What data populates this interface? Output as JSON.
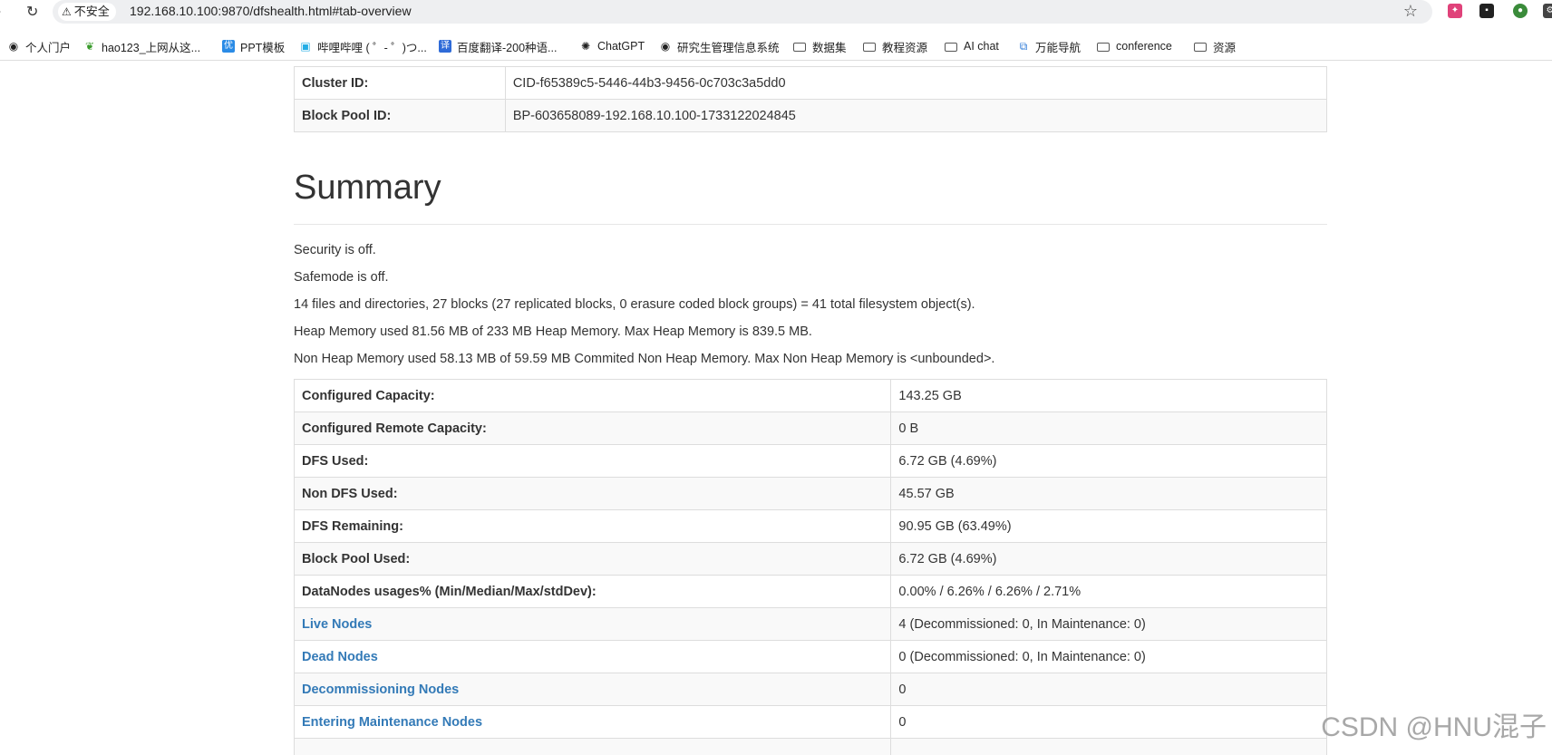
{
  "browser": {
    "security_label": "不安全",
    "url": "192.168.10.100:9870/dfshealth.html#tab-overview"
  },
  "bookmarks": [
    {
      "label": "个人门户",
      "icon": "globe-icon"
    },
    {
      "label": "hao123_上网从这...",
      "icon": "hao123-icon"
    },
    {
      "label": "PPT模板",
      "icon": "ppt-icon"
    },
    {
      "label": "哔哩哔哩 ( ゜- ゜)つ...",
      "icon": "bilibili-icon"
    },
    {
      "label": "百度翻译-200种语...",
      "icon": "translate-icon"
    },
    {
      "label": "ChatGPT",
      "icon": "chatgpt-icon"
    },
    {
      "label": "研究生管理信息系统",
      "icon": "globe-icon"
    },
    {
      "label": "数据集",
      "icon": "folder-icon"
    },
    {
      "label": "教程资源",
      "icon": "folder-icon"
    },
    {
      "label": "AI chat",
      "icon": "folder-icon"
    },
    {
      "label": "万能导航",
      "icon": "nav-icon"
    },
    {
      "label": "conference",
      "icon": "folder-icon"
    },
    {
      "label": "资源",
      "icon": "folder-icon"
    }
  ],
  "overview": {
    "rows": [
      {
        "label": "Cluster ID:",
        "value": "CID-f65389c5-5446-44b3-9456-0c703c3a5dd0"
      },
      {
        "label": "Block Pool ID:",
        "value": "BP-603658089-192.168.10.100-1733122024845"
      }
    ]
  },
  "summary": {
    "title": "Summary",
    "lines": [
      "Security is off.",
      "Safemode is off.",
      "14 files and directories, 27 blocks (27 replicated blocks, 0 erasure coded block groups) = 41 total filesystem object(s).",
      "Heap Memory used 81.56 MB of 233 MB Heap Memory. Max Heap Memory is 839.5 MB.",
      "Non Heap Memory used 58.13 MB of 59.59 MB Commited Non Heap Memory. Max Non Heap Memory is <unbounded>."
    ],
    "rows": [
      {
        "label": "Configured Capacity:",
        "value": "143.25 GB",
        "link": false
      },
      {
        "label": "Configured Remote Capacity:",
        "value": "0 B",
        "link": false
      },
      {
        "label": "DFS Used:",
        "value": "6.72 GB (4.69%)",
        "link": false
      },
      {
        "label": "Non DFS Used:",
        "value": "45.57 GB",
        "link": false
      },
      {
        "label": "DFS Remaining:",
        "value": "90.95 GB (63.49%)",
        "link": false
      },
      {
        "label": "Block Pool Used:",
        "value": "6.72 GB (4.69%)",
        "link": false
      },
      {
        "label": "DataNodes usages% (Min/Median/Max/stdDev):",
        "value": "0.00% / 6.26% / 6.26% / 2.71%",
        "link": false
      },
      {
        "label": "Live Nodes",
        "value": "4 (Decommissioned: 0, In Maintenance: 0)",
        "link": true
      },
      {
        "label": "Dead Nodes",
        "value": "0 (Decommissioned: 0, In Maintenance: 0)",
        "link": true
      },
      {
        "label": "Decommissioning Nodes",
        "value": "0",
        "link": true
      },
      {
        "label": "Entering Maintenance Nodes",
        "value": "0",
        "link": true
      },
      {
        "label": "",
        "value": "",
        "link": false
      }
    ]
  },
  "watermark": "CSDN @HNU混子",
  "colors": {
    "link": "#337ab7",
    "border": "#dddddd",
    "stripe": "#f9f9f9"
  }
}
